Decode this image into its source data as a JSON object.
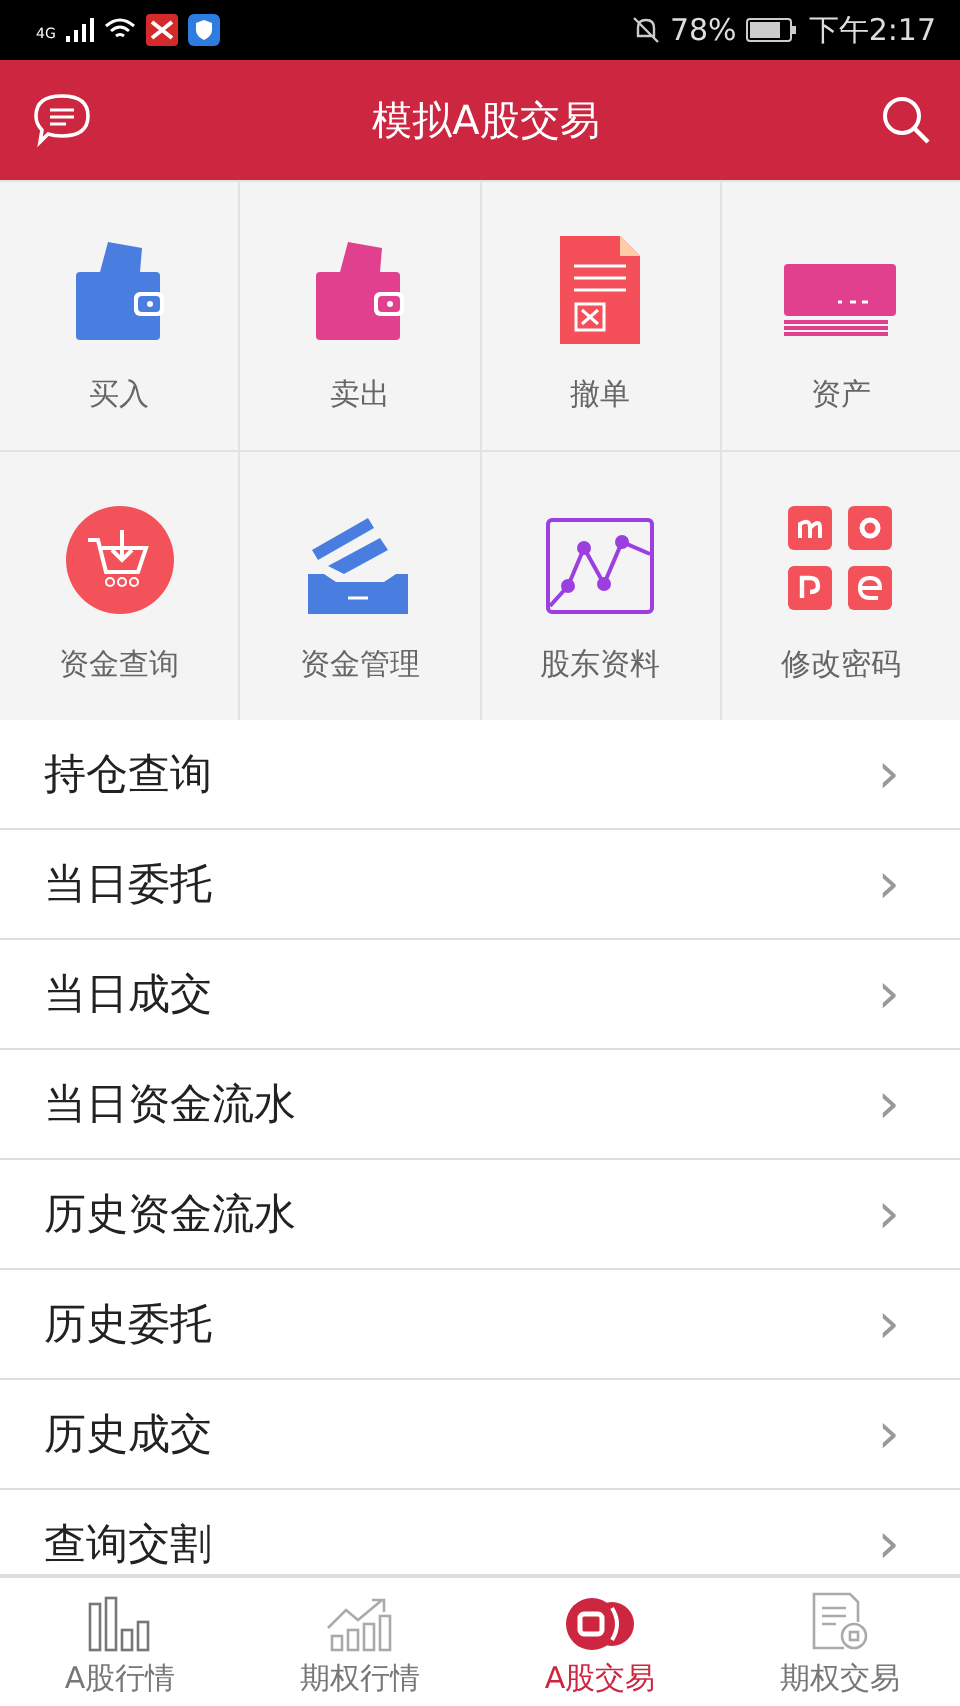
{
  "status_bar": {
    "network": "4G",
    "battery": "78%",
    "time": "下午2:17"
  },
  "header": {
    "title": "模拟A股交易"
  },
  "grid": [
    {
      "label": "买入"
    },
    {
      "label": "卖出"
    },
    {
      "label": "撤单"
    },
    {
      "label": "资产"
    },
    {
      "label": "资金查询"
    },
    {
      "label": "资金管理"
    },
    {
      "label": "股东资料"
    },
    {
      "label": "修改密码"
    }
  ],
  "menu": [
    {
      "label": "持仓查询",
      "chevron": "›"
    },
    {
      "label": "当日委托",
      "chevron": "›"
    },
    {
      "label": "当日成交",
      "chevron": "›"
    },
    {
      "label": "当日资金流水",
      "chevron": "›"
    },
    {
      "label": "历史资金流水",
      "chevron": "›"
    },
    {
      "label": "历史委托",
      "chevron": "›"
    },
    {
      "label": "历史成交",
      "chevron": "›"
    },
    {
      "label": "查询交割",
      "chevron": "›"
    }
  ],
  "tabs": [
    {
      "label": "A股行情",
      "selected": false
    },
    {
      "label": "期权行情",
      "selected": false
    },
    {
      "label": "A股交易",
      "selected": true
    },
    {
      "label": "期权交易",
      "selected": false
    }
  ]
}
